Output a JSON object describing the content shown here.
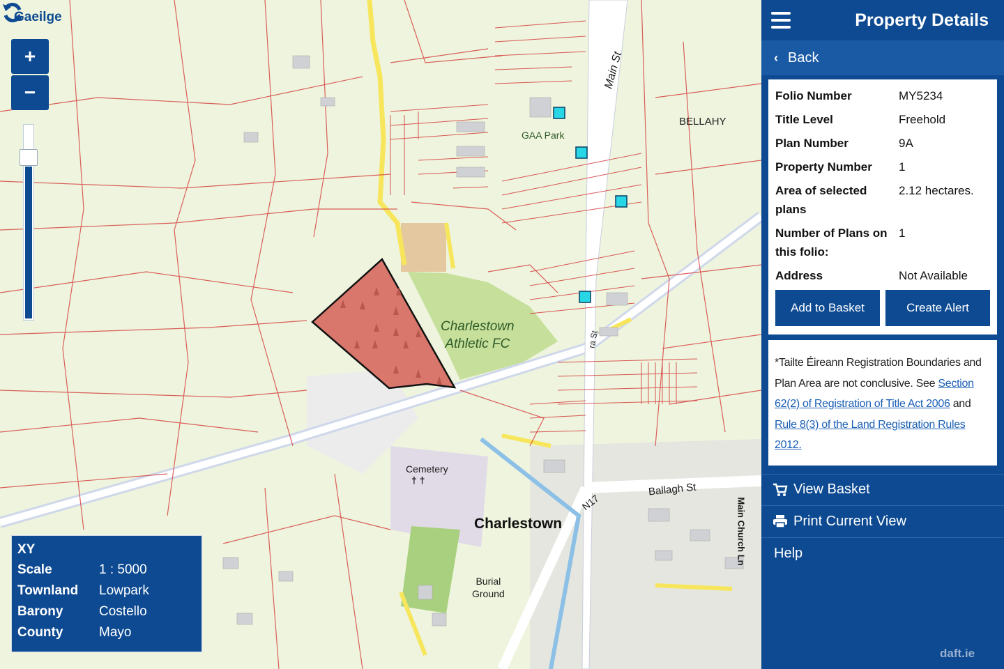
{
  "map": {
    "language_link": "Gaeilge",
    "zoom_in_label": "+",
    "zoom_out_label": "−",
    "labels": {
      "bellahy": "BELLAHY",
      "gaa_park": "GAA Park",
      "athletic_line1": "Charlestown",
      "athletic_line2": "Athletic FC",
      "cemetery": "Cemetery",
      "cemetery_symbol": "† †",
      "charlestown": "Charlestown",
      "burial_line1": "Burial",
      "burial_line2": "Ground",
      "ballagh_st": "Ballagh St",
      "n17": "N17",
      "main_st": "Main St",
      "main_st_lower": "ra St",
      "church_ln": "Main Church Ln"
    },
    "colors": {
      "parcel_fill": "#d9776c",
      "boundary": "#d53a3a",
      "road_yellow": "#f7e65c",
      "marker": "#27d7e6"
    },
    "watermark": "daft.ie"
  },
  "info_box": {
    "title": "XY",
    "rows": [
      {
        "key": "Scale",
        "value": "1 : 5000"
      },
      {
        "key": "Townland",
        "value": "Lowpark"
      },
      {
        "key": "Barony",
        "value": "Costello"
      },
      {
        "key": "County",
        "value": "Mayo"
      }
    ]
  },
  "sidebar": {
    "title": "Property Details",
    "back_label": "Back",
    "details": [
      {
        "key": "Folio Number",
        "value": "MY5234"
      },
      {
        "key": "Title Level",
        "value": "Freehold"
      },
      {
        "key": "Plan Number",
        "value": "9A"
      },
      {
        "key": "Property Number",
        "value": "1"
      },
      {
        "key": "Area of selected plans",
        "value": "2.12 hectares."
      },
      {
        "key": "Number of Plans on this folio:",
        "value": "1"
      },
      {
        "key": "Address",
        "value": "Not Available"
      }
    ],
    "add_to_basket": "Add to Basket",
    "create_alert": "Create Alert",
    "note": {
      "text1": "*Tailte Éireann Registration Boundaries and Plan Area are not conclusive. See ",
      "link1": "Section 62(2) of Registration of Title Act 2006",
      "text2": " and ",
      "link2": "Rule 8(3) of the Land Registration Rules 2012."
    },
    "menu": {
      "view_basket": "View Basket",
      "print_view": "Print Current View",
      "help": "Help"
    },
    "colors": {
      "primary": "#0d4a92",
      "link": "#1a5fb4"
    }
  }
}
